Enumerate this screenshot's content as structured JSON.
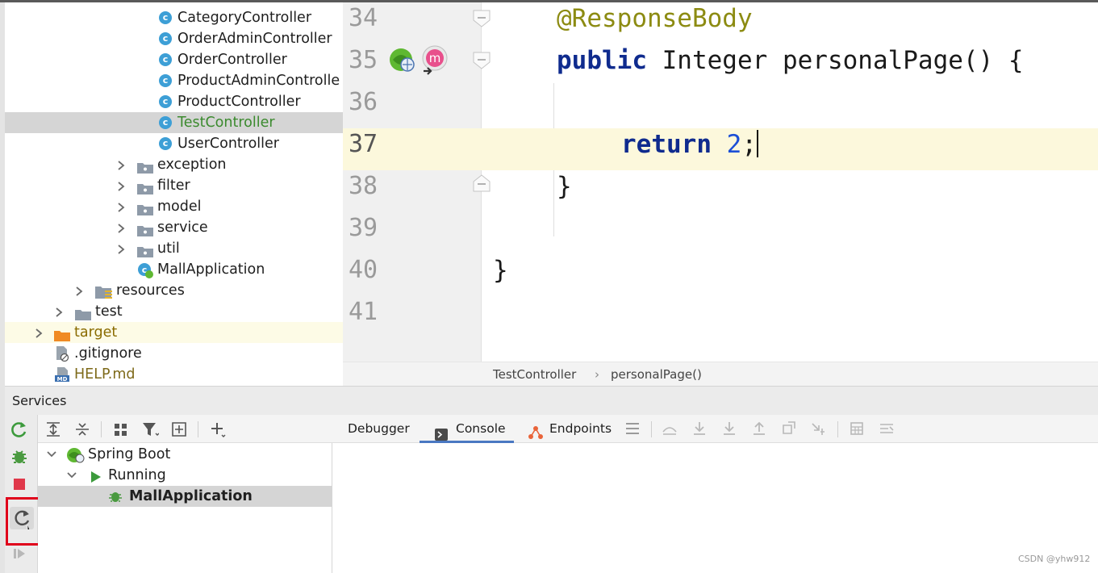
{
  "project_tree": {
    "items": [
      {
        "label": "CategoryController",
        "kind": "class"
      },
      {
        "label": "OrderAdminController",
        "kind": "class"
      },
      {
        "label": "OrderController",
        "kind": "class"
      },
      {
        "label": "ProductAdminControlle",
        "kind": "class"
      },
      {
        "label": "ProductController",
        "kind": "class"
      },
      {
        "label": "TestController",
        "kind": "class",
        "selected": true
      },
      {
        "label": "UserController",
        "kind": "class"
      },
      {
        "label": "exception",
        "kind": "package"
      },
      {
        "label": "filter",
        "kind": "package"
      },
      {
        "label": "model",
        "kind": "package"
      },
      {
        "label": "service",
        "kind": "package"
      },
      {
        "label": "util",
        "kind": "package"
      },
      {
        "label": "MallApplication",
        "kind": "spring-app"
      },
      {
        "label": "resources",
        "kind": "resources-folder"
      },
      {
        "label": "test",
        "kind": "folder"
      },
      {
        "label": "target",
        "kind": "excluded-folder"
      },
      {
        "label": ".gitignore",
        "kind": "file"
      },
      {
        "label": "HELP.md",
        "kind": "markdown"
      }
    ]
  },
  "editor": {
    "lines": [
      {
        "number": "34",
        "annotation": "@ResponseBody"
      },
      {
        "number": "35",
        "keyword": "public",
        "text": " Integer personalPage() {"
      },
      {
        "number": "36"
      },
      {
        "number": "37",
        "keyword": "return",
        "value": "2",
        "suffix": ";"
      },
      {
        "number": "38",
        "text": "}"
      },
      {
        "number": "39"
      },
      {
        "number": "40",
        "text": "}"
      },
      {
        "number": "41"
      }
    ],
    "gutter_badge": "m"
  },
  "breadcrumb": {
    "items": [
      "TestController",
      "personalPage()"
    ],
    "separator": "›"
  },
  "services": {
    "title": "Services",
    "tree": [
      {
        "label": "Spring Boot"
      },
      {
        "label": "Running"
      },
      {
        "label": "MallApplication",
        "selected": true
      }
    ],
    "tabs": [
      {
        "label": "Debugger"
      },
      {
        "label": "Console",
        "active": true
      },
      {
        "label": "Endpoints"
      }
    ]
  },
  "colors": {
    "selection_green": "#3b8a2e",
    "keyword_blue": "#0f2b8e",
    "annotation_olive": "#8c8b12",
    "highlight_red": "#e0001b",
    "current_line": "#fcf8dc"
  },
  "watermark": "CSDN @yhw912"
}
